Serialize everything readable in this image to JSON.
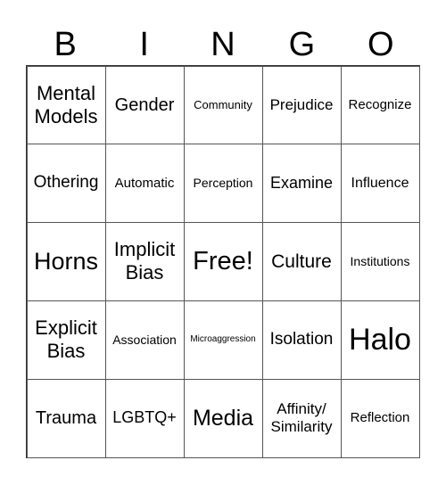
{
  "header": [
    "B",
    "I",
    "N",
    "G",
    "O"
  ],
  "cells": [
    [
      "Mental Models",
      "Gender",
      "Community",
      "Prejudice",
      "Recognize"
    ],
    [
      "Othering",
      "Automatic",
      "Perception",
      "Examine",
      "Influence"
    ],
    [
      "Horns",
      "Implicit Bias",
      "Free!",
      "Culture",
      "Institutions"
    ],
    [
      "Explicit Bias",
      "Association",
      "Microaggression",
      "Isolation",
      "Halo"
    ],
    [
      "Trauma",
      "LGBTQ+",
      "Media",
      "Affinity/ Similarity",
      "Reflection"
    ]
  ]
}
